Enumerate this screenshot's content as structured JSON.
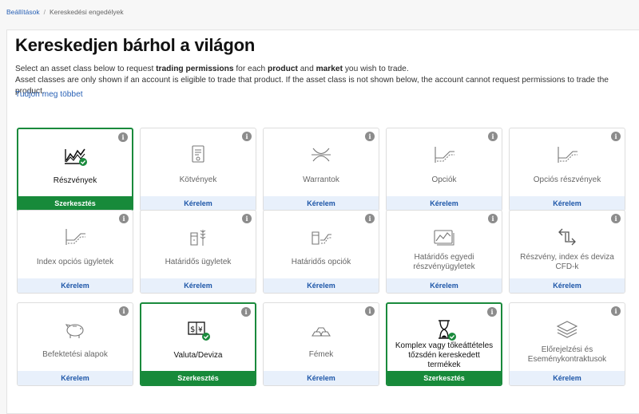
{
  "breadcrumb": {
    "settings": "Beállítások",
    "separator": "/",
    "current": "Kereskedési engedélyek"
  },
  "header": {
    "title": "Kereskedjen bárhol a világon",
    "line1_a": "Select an asset class below to request ",
    "line1_b": "trading permissions",
    "line1_c": " for each ",
    "line1_d": "product",
    "line1_e": " and ",
    "line1_f": "market",
    "line1_g": " you wish to trade.",
    "line2": "Asset classes are only shown if an account is eligible to trade that product. If the asset class is not shown below, the account cannot request permissions to trade the product.",
    "learn_more": "Tudjon meg többet"
  },
  "info_glyph": "i",
  "cards": [
    {
      "label": "Részvények",
      "action": "Szerkesztés",
      "icon": "stocks-icon"
    },
    {
      "label": "Kötvények",
      "action": "Kérelem",
      "icon": "bond-icon"
    },
    {
      "label": "Warrantok",
      "action": "Kérelem",
      "icon": "warrant-icon"
    },
    {
      "label": "Opciók",
      "action": "Kérelem",
      "icon": "options-icon"
    },
    {
      "label": "Opciós részvények",
      "action": "Kérelem",
      "icon": "options-icon"
    },
    {
      "label": "Index opciós ügyletek",
      "action": "Kérelem",
      "icon": "options-icon"
    },
    {
      "label": "Határidős ügyletek",
      "action": "Kérelem",
      "icon": "futures-icon"
    },
    {
      "label": "Határidős opciók",
      "action": "Kérelem",
      "icon": "futures-options-icon"
    },
    {
      "label": "Határidős egyedi részvényügyletek",
      "action": "Kérelem",
      "icon": "single-stock-futures-icon"
    },
    {
      "label": "Részvény, index és deviza CFD-k",
      "action": "Kérelem",
      "icon": "cfd-icon"
    },
    {
      "label": "Befektetési alapok",
      "action": "Kérelem",
      "icon": "piggy-bank-icon"
    },
    {
      "label": "Valuta/Deviza",
      "action": "Szerkesztés",
      "icon": "currency-icon"
    },
    {
      "label": "Fémek",
      "action": "Kérelem",
      "icon": "metals-icon"
    },
    {
      "label": "Komplex vagy tőkeáttételes tőzsdén kereskedett termékek",
      "action": "Szerkesztés",
      "icon": "hourglass-icon"
    },
    {
      "label": "Előrejelzési és Eseménykontraktusok",
      "action": "Kérelem",
      "icon": "layers-icon"
    }
  ],
  "colors": {
    "active": "#1a8a3c",
    "link": "#2a62b6",
    "request_bg": "#e8f0fb"
  }
}
